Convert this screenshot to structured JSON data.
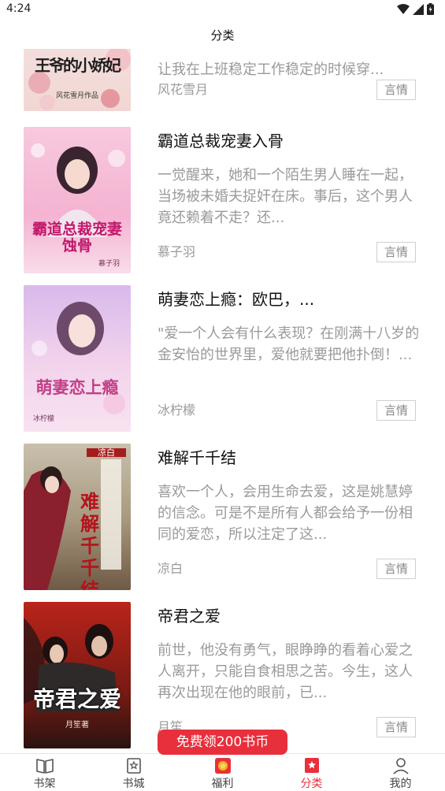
{
  "status": {
    "time": "4:24"
  },
  "header": {
    "title": "分类"
  },
  "books": [
    {
      "title": "",
      "desc": "让我在上班稳定工作稳定的时候穿...",
      "author": "风花雪月",
      "tag": "言情",
      "cover_text": "王爷的小娇妃",
      "cover_sub": "风花雪月作品"
    },
    {
      "title": "霸道总裁宠妻入骨",
      "desc": "一觉醒来，她和一个陌生男人睡在一起，当场被未婚夫捉奸在床。事后，这个男人竟还赖着不走？还...",
      "author": "慕子羽",
      "tag": "言情",
      "cover_text": "霸道总裁宠妻蚀骨",
      "cover_sub": "慕子羽"
    },
    {
      "title": "萌妻恋上瘾：欧巴，...",
      "desc": "\"爱一个人会有什么表现？在刚满十八岁的金安怡的世界里，爱他就要把他扑倒！...",
      "author": "冰柠檬",
      "tag": "言情",
      "cover_text": "萌妻恋上瘾",
      "cover_sub": "冰柠檬"
    },
    {
      "title": "难解千千结",
      "desc": "喜欢一个人，会用生命去爱，这是姚慧婷的信念。可是不是所有人都会给予一份相同的爱恋，所以注定了这...",
      "author": "凉白",
      "tag": "言情",
      "cover_text": "难解千千结",
      "cover_sub": "凉白"
    },
    {
      "title": "帝君之爱",
      "desc": "前世，他没有勇气，眼睁睁的看着心爱之人离开，只能自食相思之苦。今生，这人再次出现在他的眼前，已...",
      "author": "月笙",
      "tag": "言情",
      "cover_text": "帝君之爱",
      "cover_sub": "月笙著"
    }
  ],
  "promo": {
    "label": "免费领200书币"
  },
  "nav": [
    {
      "label": "书架",
      "icon": "book-icon"
    },
    {
      "label": "书城",
      "icon": "store-icon"
    },
    {
      "label": "福利",
      "icon": "gift-icon"
    },
    {
      "label": "分类",
      "icon": "category-icon"
    },
    {
      "label": "我的",
      "icon": "profile-icon"
    }
  ],
  "colors": {
    "accent": "#e8303c",
    "muted": "#9a9a9a"
  }
}
